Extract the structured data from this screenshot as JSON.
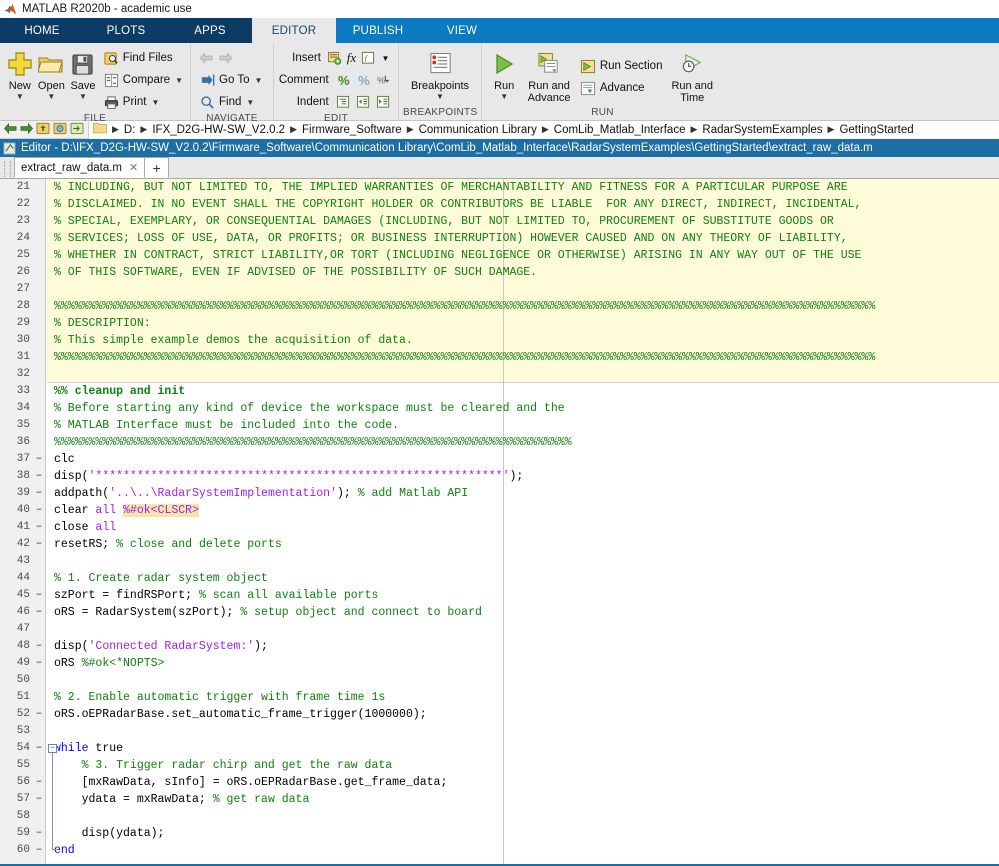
{
  "window": {
    "title": "MATLAB R2020b - academic use",
    "app_icon": "matlab-logo-icon"
  },
  "ribbon_tabs": [
    {
      "label": "HOME",
      "active": false
    },
    {
      "label": "PLOTS",
      "active": false
    },
    {
      "label": "APPS",
      "active": false
    },
    {
      "label": "EDITOR",
      "active": true
    },
    {
      "label": "PUBLISH",
      "active": false
    },
    {
      "label": "VIEW",
      "active": false
    }
  ],
  "ribbon": {
    "file_group": {
      "label": "FILE",
      "new": "New",
      "open": "Open",
      "save": "Save",
      "find_files": "Find Files",
      "compare": "Compare",
      "print": "Print"
    },
    "navigate_group": {
      "label": "NAVIGATE",
      "go_to": "Go To",
      "find": "Find"
    },
    "edit_group": {
      "label": "EDIT",
      "insert": "Insert",
      "comment": "Comment",
      "indent": "Indent"
    },
    "breakpoints_group": {
      "label": "BREAKPOINTS",
      "breakpoints": "Breakpoints"
    },
    "run_group": {
      "label": "RUN",
      "run": "Run",
      "run_and_advance": "Run and Advance",
      "run_section": "Run Section",
      "advance": "Advance",
      "run_and_time": "Run and Time"
    }
  },
  "pathbar": {
    "crumbs": [
      "D:",
      "IFX_D2G-HW-SW_V2.0.2",
      "Firmware_Software",
      "Communication Library",
      "ComLib_Matlab_Interface",
      "RadarSystemExamples",
      "GettingStarted"
    ]
  },
  "editor_titlebar": {
    "text": "Editor - D:\\IFX_D2G-HW-SW_V2.0.2\\Firmware_Software\\Communication Library\\ComLib_Matlab_Interface\\RadarSystemExamples\\GettingStarted\\extract_raw_data.m"
  },
  "doctabs": {
    "tabs": [
      {
        "label": "extract_raw_data.m",
        "close": "✕",
        "active": true
      }
    ],
    "new_tab": "+"
  },
  "code": {
    "first_line_number": 21,
    "highlight_end_line": 32,
    "lines": [
      {
        "n": 21,
        "mark": "",
        "tokens": [
          {
            "t": "% INCLUDING, BUT NOT LIMITED TO, THE IMPLIED WARRANTIES OF MERCHANTABILITY AND FITNESS FOR A PARTICULAR PURPOSE ARE",
            "c": "c-comment"
          }
        ]
      },
      {
        "n": 22,
        "mark": "",
        "tokens": [
          {
            "t": "% DISCLAIMED. IN NO EVENT SHALL THE COPYRIGHT HOLDER OR CONTRIBUTORS BE LIABLE  FOR ANY DIRECT, INDIRECT, INCIDENTAL,",
            "c": "c-comment"
          }
        ]
      },
      {
        "n": 23,
        "mark": "",
        "tokens": [
          {
            "t": "% SPECIAL, EXEMPLARY, OR CONSEQUENTIAL DAMAGES (INCLUDING, BUT NOT LIMITED TO, PROCUREMENT OF SUBSTITUTE GOODS OR",
            "c": "c-comment"
          }
        ]
      },
      {
        "n": 24,
        "mark": "",
        "tokens": [
          {
            "t": "% SERVICES; LOSS OF USE, DATA, OR PROFITS; OR BUSINESS INTERRUPTION) HOWEVER CAUSED AND ON ANY THEORY OF LIABILITY,",
            "c": "c-comment"
          }
        ]
      },
      {
        "n": 25,
        "mark": "",
        "tokens": [
          {
            "t": "% WHETHER IN CONTRACT, STRICT LIABILITY,OR TORT (INCLUDING NEGLIGENCE OR OTHERWISE) ARISING IN ANY WAY OUT OF THE USE",
            "c": "c-comment"
          }
        ]
      },
      {
        "n": 26,
        "mark": "",
        "tokens": [
          {
            "t": "% OF THIS SOFTWARE, EVEN IF ADVISED OF THE POSSIBILITY OF SUCH DAMAGE.",
            "c": "c-comment"
          }
        ]
      },
      {
        "n": 27,
        "mark": "",
        "tokens": []
      },
      {
        "n": 28,
        "mark": "",
        "tokens": [
          {
            "t": "%%%%%%%%%%%%%%%%%%%%%%%%%%%%%%%%%%%%%%%%%%%%%%%%%%%%%%%%%%%%%%%%%%%%%%%%%%%%%%%%%%%%%%%%%%%%%%%%%%%%%%%%%%%%%%%%%%%%%%%",
            "c": "c-comment"
          }
        ]
      },
      {
        "n": 29,
        "mark": "",
        "tokens": [
          {
            "t": "% DESCRIPTION:",
            "c": "c-comment"
          }
        ]
      },
      {
        "n": 30,
        "mark": "",
        "tokens": [
          {
            "t": "% This simple example demos the acquisition of data.",
            "c": "c-comment"
          }
        ]
      },
      {
        "n": 31,
        "mark": "",
        "tokens": [
          {
            "t": "%%%%%%%%%%%%%%%%%%%%%%%%%%%%%%%%%%%%%%%%%%%%%%%%%%%%%%%%%%%%%%%%%%%%%%%%%%%%%%%%%%%%%%%%%%%%%%%%%%%%%%%%%%%%%%%%%%%%%%%",
            "c": "c-comment"
          }
        ]
      },
      {
        "n": 32,
        "mark": "",
        "tokens": []
      },
      {
        "n": 33,
        "mark": "",
        "tokens": [
          {
            "t": "%% cleanup and init",
            "c": "c-section"
          }
        ]
      },
      {
        "n": 34,
        "mark": "",
        "tokens": [
          {
            "t": "% Before starting any kind of device the workspace must be cleared and the",
            "c": "c-comment"
          }
        ]
      },
      {
        "n": 35,
        "mark": "",
        "tokens": [
          {
            "t": "% MATLAB Interface must be included into the code.",
            "c": "c-comment"
          }
        ]
      },
      {
        "n": 36,
        "mark": "",
        "tokens": [
          {
            "t": "%%%%%%%%%%%%%%%%%%%%%%%%%%%%%%%%%%%%%%%%%%%%%%%%%%%%%%%%%%%%%%%%%%%%%%%%%%%",
            "c": "c-comment"
          }
        ]
      },
      {
        "n": 37,
        "mark": "–",
        "tokens": [
          {
            "t": "clc",
            "c": "c-plain"
          }
        ]
      },
      {
        "n": 38,
        "mark": "–",
        "tokens": [
          {
            "t": "disp(",
            "c": "c-plain"
          },
          {
            "t": "'***********************************************************'",
            "c": "c-string"
          },
          {
            "t": ");",
            "c": "c-plain"
          }
        ]
      },
      {
        "n": 39,
        "mark": "–",
        "tokens": [
          {
            "t": "addpath(",
            "c": "c-plain"
          },
          {
            "t": "'..\\..\\RadarSystemImplementation'",
            "c": "c-string"
          },
          {
            "t": "); ",
            "c": "c-plain"
          },
          {
            "t": "% add Matlab API",
            "c": "c-comment"
          }
        ]
      },
      {
        "n": 40,
        "mark": "–",
        "tokens": [
          {
            "t": "clear ",
            "c": "c-plain"
          },
          {
            "t": "all",
            "c": "c-string"
          },
          {
            "t": " ",
            "c": "c-plain"
          },
          {
            "t": "%#ok<CLSCR>",
            "c": "c-warnpurple"
          }
        ]
      },
      {
        "n": 41,
        "mark": "–",
        "tokens": [
          {
            "t": "close ",
            "c": "c-plain"
          },
          {
            "t": "all",
            "c": "c-string"
          }
        ]
      },
      {
        "n": 42,
        "mark": "–",
        "tokens": [
          {
            "t": "resetRS; ",
            "c": "c-plain"
          },
          {
            "t": "% close and delete ports",
            "c": "c-comment"
          }
        ]
      },
      {
        "n": 43,
        "mark": "",
        "tokens": []
      },
      {
        "n": 44,
        "mark": "",
        "tokens": [
          {
            "t": "% 1. Create radar system object",
            "c": "c-comment"
          }
        ]
      },
      {
        "n": 45,
        "mark": "–",
        "tokens": [
          {
            "t": "szPort = findRSPort; ",
            "c": "c-plain"
          },
          {
            "t": "% scan all available ports",
            "c": "c-comment"
          }
        ]
      },
      {
        "n": 46,
        "mark": "–",
        "tokens": [
          {
            "t": "oRS = RadarSystem(szPort); ",
            "c": "c-plain"
          },
          {
            "t": "% setup object and connect to board",
            "c": "c-comment"
          }
        ]
      },
      {
        "n": 47,
        "mark": "",
        "tokens": []
      },
      {
        "n": 48,
        "mark": "–",
        "tokens": [
          {
            "t": "disp(",
            "c": "c-plain"
          },
          {
            "t": "'Connected RadarSystem:'",
            "c": "c-string"
          },
          {
            "t": ");",
            "c": "c-plain"
          }
        ]
      },
      {
        "n": 49,
        "mark": "–",
        "tokens": [
          {
            "t": "oRS ",
            "c": "c-plain"
          },
          {
            "t": "%#ok<*NOPTS>",
            "c": "c-comment"
          }
        ]
      },
      {
        "n": 50,
        "mark": "",
        "tokens": []
      },
      {
        "n": 51,
        "mark": "",
        "tokens": [
          {
            "t": "% 2. Enable automatic trigger with frame time 1s",
            "c": "c-comment"
          }
        ]
      },
      {
        "n": 52,
        "mark": "–",
        "tokens": [
          {
            "t": "oRS.oEPRadarBase.set_automatic_frame_trigger(1000000);",
            "c": "c-plain"
          }
        ]
      },
      {
        "n": 53,
        "mark": "",
        "tokens": []
      },
      {
        "n": 54,
        "mark": "–",
        "tokens": [
          {
            "t": "while ",
            "c": "c-keyword"
          },
          {
            "t": "true",
            "c": "c-plain"
          }
        ]
      },
      {
        "n": 55,
        "mark": "",
        "tokens": [
          {
            "t": "    % 3. Trigger radar chirp and get the raw data",
            "c": "c-comment"
          }
        ]
      },
      {
        "n": 56,
        "mark": "–",
        "tokens": [
          {
            "t": "    [mxRawData, sInfo] = oRS.oEPRadarBase.get_frame_data;",
            "c": "c-plain"
          }
        ]
      },
      {
        "n": 57,
        "mark": "–",
        "tokens": [
          {
            "t": "    ydata = mxRawData; ",
            "c": "c-plain"
          },
          {
            "t": "% get raw data",
            "c": "c-comment"
          }
        ]
      },
      {
        "n": 58,
        "mark": "",
        "tokens": []
      },
      {
        "n": 59,
        "mark": "–",
        "tokens": [
          {
            "t": "    disp(ydata);",
            "c": "c-plain"
          }
        ]
      },
      {
        "n": 60,
        "mark": "–",
        "tokens": [
          {
            "t": "end",
            "c": "c-keyword"
          }
        ]
      }
    ]
  },
  "colors": {
    "ribbon_dark_blue": "#0c3c66",
    "ribbon_light_blue": "#0b7ac0",
    "editor_title_blue": "#1c6ea4",
    "ribbon_bg": "#e8e8e8",
    "comment_green": "#108010",
    "string_purple": "#a020f0",
    "keyword_blue": "#0000ff",
    "warning_highlight": "#f5e6a8",
    "section_highlight": "#fdfbd8"
  }
}
